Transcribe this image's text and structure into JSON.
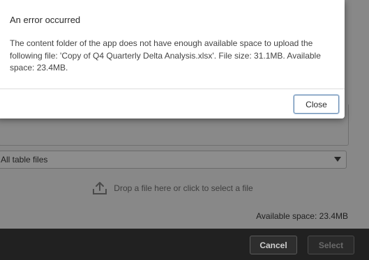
{
  "error_dialog": {
    "title": "An error occurred",
    "message": "The content folder of the app does not have enough available space to upload the following file: 'Copy of Q4 Quarterly Delta Analysis.xlsx'. File size: 31.1MB. Available space: 23.4MB.",
    "close_label": "Close"
  },
  "file_dialog": {
    "filetype_selected": "All table files",
    "drop_text": "Drop a file here or click to select a file",
    "upload_icon": "upload-icon",
    "available_space": "Available space: 23.4MB",
    "cancel_label": "Cancel",
    "select_label": "Select"
  },
  "colors": {
    "overlay": "#888888",
    "footer": "#212121",
    "dialog_bg": "#ffffff",
    "focus_border": "#6e90b5"
  }
}
